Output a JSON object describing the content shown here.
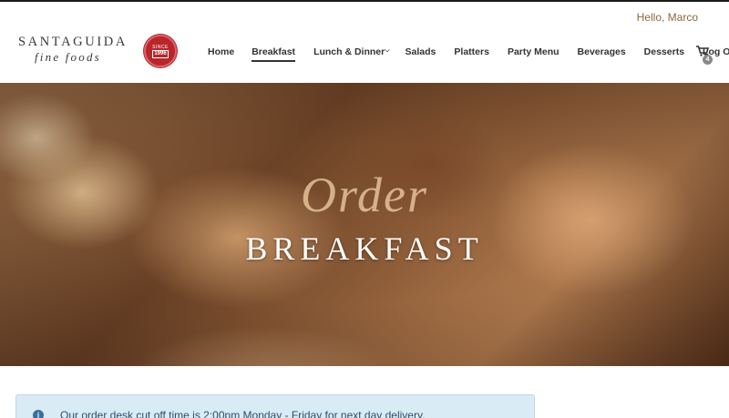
{
  "header": {
    "greeting": "Hello, Marco",
    "logo_name": "SANTAGUIDA",
    "logo_sub": "fine foods",
    "seal_line1": "SINCE",
    "seal_line2": "1996"
  },
  "nav": {
    "items": [
      {
        "label": "Home",
        "active": false
      },
      {
        "label": "Breakfast",
        "active": true
      },
      {
        "label": "Lunch & Dinner",
        "active": false,
        "has_dropdown": true
      },
      {
        "label": "Salads",
        "active": false
      },
      {
        "label": "Platters",
        "active": false
      },
      {
        "label": "Party Menu",
        "active": false
      },
      {
        "label": "Beverages",
        "active": false
      },
      {
        "label": "Desserts",
        "active": false
      },
      {
        "label": "Log Out",
        "active": false
      }
    ],
    "cart_count": "4"
  },
  "hero": {
    "script_text": "Order",
    "title": "BREAKFAST"
  },
  "notice": {
    "text": "Our order desk cut off time is 2:00pm Monday - Friday for next day delivery."
  },
  "colors": {
    "accent": "#8a6a3a",
    "seal_red": "#b8262b",
    "notice_bg": "#d9ebf5"
  }
}
